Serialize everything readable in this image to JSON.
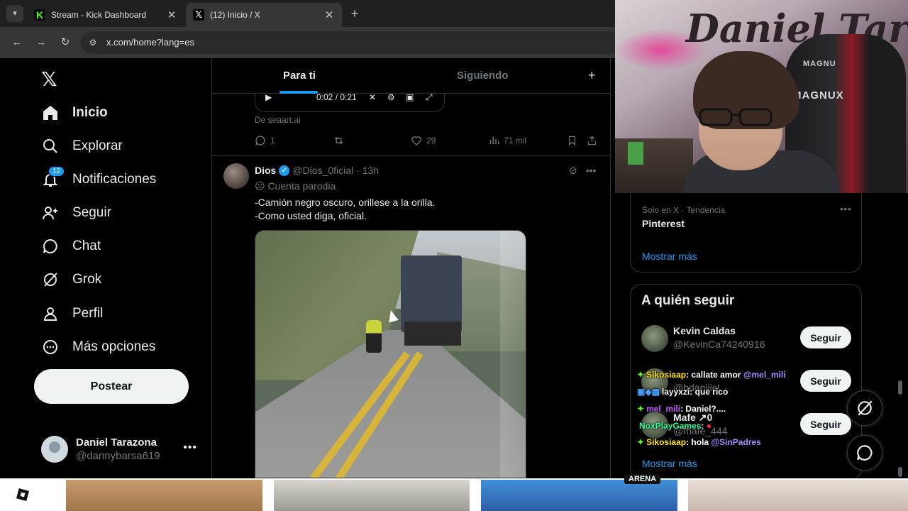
{
  "browser": {
    "tabs": [
      {
        "title": "Stream - Kick Dashboard",
        "favicon": "kick-icon",
        "active": false
      },
      {
        "title": "(12) Inicio / X",
        "favicon": "x-icon",
        "active": true
      }
    ],
    "url": "x.com/home?lang=es"
  },
  "nav": {
    "items": [
      {
        "label": "Inicio",
        "icon": "home-icon",
        "bold": true
      },
      {
        "label": "Explorar",
        "icon": "search-icon"
      },
      {
        "label": "Notificaciones",
        "icon": "bell-icon",
        "badge": "12"
      },
      {
        "label": "Seguir",
        "icon": "add-user-icon"
      },
      {
        "label": "Chat",
        "icon": "chat-icon"
      },
      {
        "label": "Grok",
        "icon": "grok-icon"
      },
      {
        "label": "Perfil",
        "icon": "profile-icon"
      },
      {
        "label": "Más opciones",
        "icon": "more-circle-icon"
      }
    ],
    "post_button": "Postear",
    "account": {
      "name": "Daniel Tarazona",
      "handle": "@dannybarsa619"
    }
  },
  "timeline": {
    "tabs": [
      "Para ti",
      "Siguiendo"
    ],
    "prev_post": {
      "video_time": "0:02 / 0:21",
      "source": "De seaart.ai",
      "replies": "1",
      "likes": "29",
      "views": "71 mil"
    },
    "post": {
      "name": "Dios",
      "handle": "@Dios_0ficial",
      "time": "· 13h",
      "label": "Cuenta parodia",
      "text_line1": "-Camión negro oscuro, orillese a la orilla.",
      "text_line2": "-Como usted diga, oficial."
    }
  },
  "sidebar": {
    "trend": {
      "meta": "Solo en X · Tendencia",
      "name": "Pinterest",
      "show_more": "Mostrar más"
    },
    "who_to_follow": {
      "title": "A quién seguir",
      "users": [
        {
          "name": "Kevin Caldas",
          "handle": "@KevinCa74240916",
          "button": "Seguir"
        },
        {
          "name": "",
          "handle": "@hdaniiiel",
          "button": "Seguir"
        },
        {
          "name": "Mafe ↗0",
          "handle": "@mafe_444",
          "button": "Seguir"
        }
      ],
      "show_more": "Mostrar más"
    }
  },
  "chat_overlay": [
    {
      "user": "Sikosiaap",
      "message": ": callate amor",
      "mention": "@mel_mili",
      "color": "#ffe600"
    },
    {
      "user": "layyxzi",
      "message": ": que rico",
      "mention": "",
      "color": "#ffffff"
    },
    {
      "user": "mel_mili",
      "message": ": Daniel?....",
      "mention": "",
      "color": "#c15cff"
    },
    {
      "user": "NoxPlayGames",
      "message": ":",
      "mention": "",
      "color": "#33ff9c"
    },
    {
      "user": "Sikosiaap",
      "message": ": hola",
      "mention": "@SinPadres",
      "color": "#ffe600"
    }
  ],
  "webcam": {
    "graffiti": "Daniel Tara",
    "chair_brand": "MAGNUX",
    "chair_brand_small": "MAGNU"
  },
  "bottom_strip": {
    "arena_label": "ARENA"
  },
  "colors": {
    "accent": "#1d9bf0",
    "background": "#000000",
    "kick_green": "#53fc18"
  }
}
